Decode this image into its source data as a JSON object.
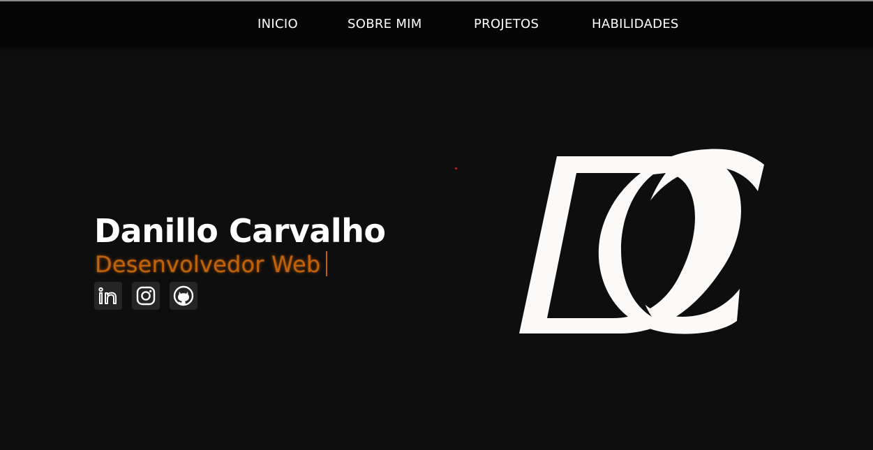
{
  "nav": {
    "items": [
      {
        "label": "INICIO"
      },
      {
        "label": "SOBRE MIM"
      },
      {
        "label": "PROJETOS"
      },
      {
        "label": "HABILIDADES"
      }
    ]
  },
  "hero": {
    "name": "Danillo Carvalho",
    "role": "Desenvolvedor Web"
  },
  "social": [
    {
      "icon": "linkedin-icon"
    },
    {
      "icon": "instagram-icon"
    },
    {
      "icon": "github-icon"
    }
  ],
  "colors": {
    "background": "#0e0e0e",
    "navbar": "#050505",
    "accent": "#c0620b",
    "logo": "#fbfaf8",
    "social_bg": "#252525"
  }
}
